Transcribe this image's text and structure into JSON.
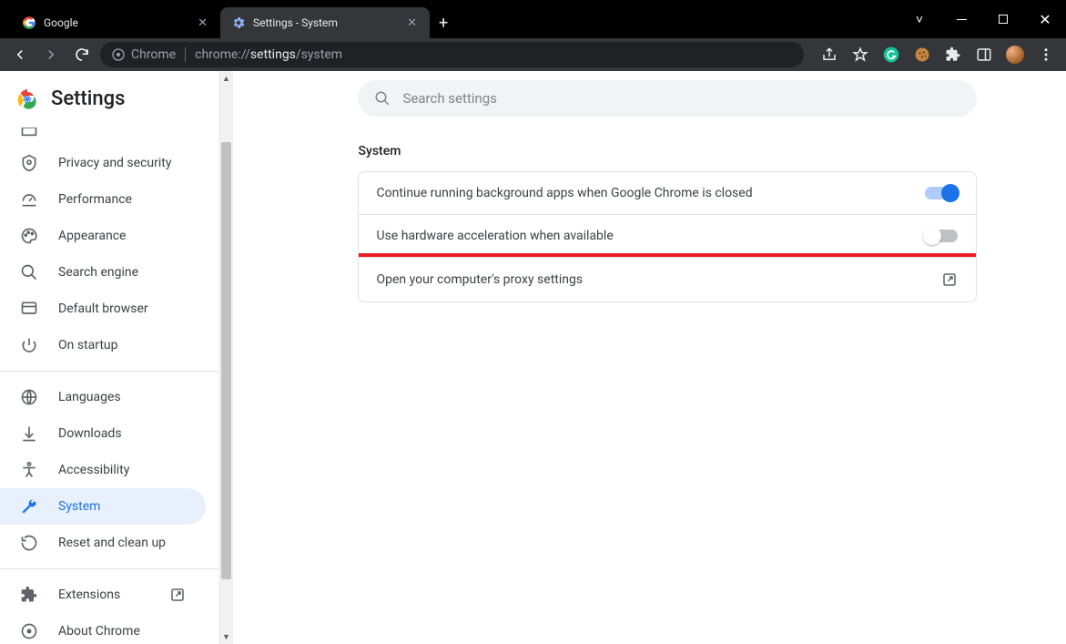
{
  "window": {
    "tabs": [
      {
        "title": "Google",
        "favicon": "google"
      },
      {
        "title": "Settings - System",
        "favicon": "gear"
      }
    ],
    "active_tab_index": 1
  },
  "omnibox": {
    "scheme_label": "Chrome",
    "url_prefix": "chrome://",
    "url_bold": "settings",
    "url_suffix": "/system"
  },
  "toolbar_extensions": {
    "icons": [
      "share-icon",
      "star-icon",
      "grammarly-icon",
      "cookie-icon",
      "puzzle-icon",
      "reader-icon"
    ]
  },
  "sidebar": {
    "title": "Settings",
    "items": [
      {
        "icon": "person-partial",
        "label": ""
      },
      {
        "icon": "shield",
        "label": "Privacy and security"
      },
      {
        "icon": "speed",
        "label": "Performance"
      },
      {
        "icon": "palette",
        "label": "Appearance"
      },
      {
        "icon": "search",
        "label": "Search engine"
      },
      {
        "icon": "browser",
        "label": "Default browser"
      },
      {
        "icon": "power",
        "label": "On startup"
      },
      {
        "sep": true
      },
      {
        "icon": "globe",
        "label": "Languages"
      },
      {
        "icon": "download",
        "label": "Downloads"
      },
      {
        "icon": "accessibility",
        "label": "Accessibility"
      },
      {
        "icon": "wrench",
        "label": "System",
        "selected": true
      },
      {
        "icon": "restore",
        "label": "Reset and clean up"
      },
      {
        "sep": true
      },
      {
        "icon": "puzzle",
        "label": "Extensions",
        "external": true
      },
      {
        "icon": "about",
        "label": "About Chrome"
      }
    ]
  },
  "search": {
    "placeholder": "Search settings"
  },
  "section": {
    "title": "System",
    "rows": [
      {
        "label": "Continue running background apps when Google Chrome is closed",
        "type": "toggle",
        "value": true
      },
      {
        "label": "Use hardware acceleration when available",
        "type": "toggle",
        "value": false
      },
      {
        "label": "Open your computer's proxy settings",
        "type": "link",
        "highlight": true
      }
    ]
  }
}
